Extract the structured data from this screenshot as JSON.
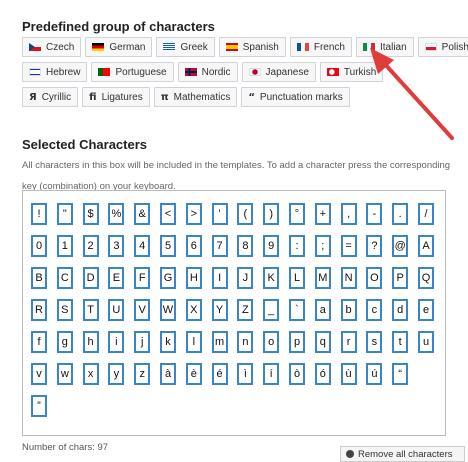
{
  "predefined": {
    "title": "Predefined group of characters",
    "row1": [
      {
        "label": "Czech",
        "icon": "czech-flag-icon"
      },
      {
        "label": "German",
        "icon": "german-flag-icon"
      },
      {
        "label": "Greek",
        "icon": "greek-flag-icon"
      },
      {
        "label": "Spanish",
        "icon": "spanish-flag-icon"
      },
      {
        "label": "French",
        "icon": "french-flag-icon"
      },
      {
        "label": "Italian",
        "icon": "italian-flag-icon"
      },
      {
        "label": "Polish",
        "icon": "polish-flag-icon"
      }
    ],
    "row2": [
      {
        "label": "Hebrew",
        "icon": "israeli-flag-icon"
      },
      {
        "label": "Portuguese",
        "icon": "portuguese-flag-icon"
      },
      {
        "label": "Nordic",
        "icon": "norwegian-flag-icon"
      },
      {
        "label": "Japanese",
        "icon": "japanese-flag-icon"
      },
      {
        "label": "Turkish",
        "icon": "turkish-flag-icon"
      }
    ],
    "row3": [
      {
        "label": "Cyrillic",
        "symbol": "Я",
        "icon": "cyrillic-icon"
      },
      {
        "label": "Ligatures",
        "symbol": "ﬁ",
        "icon": "ligature-icon"
      },
      {
        "label": "Mathematics",
        "symbol": "π",
        "icon": "pi-icon"
      },
      {
        "label": "Punctuation marks",
        "symbol": "“",
        "icon": "quote-icon"
      }
    ]
  },
  "selected": {
    "title": "Selected Characters",
    "description": "All characters in this box will be included in the templates. To add a character press the corresponding key (combination) on your keyboard.",
    "characters": [
      [
        "!",
        "\"",
        "$",
        "%",
        "&",
        "<",
        ">",
        "'",
        "(",
        ")",
        "°",
        "+",
        ",",
        "-",
        ".",
        "/"
      ],
      [
        "0",
        "1",
        "2",
        "3",
        "4",
        "5",
        "6",
        "7",
        "8",
        "9",
        ":",
        ";",
        "=",
        "?",
        "@",
        "A"
      ],
      [
        "B",
        "C",
        "D",
        "E",
        "F",
        "G",
        "H",
        "I",
        "J",
        "K",
        "L",
        "M",
        "N",
        "O",
        "P",
        "Q"
      ],
      [
        "R",
        "S",
        "T",
        "U",
        "V",
        "W",
        "X",
        "Y",
        "Z",
        "_",
        "`",
        "a",
        "b",
        "c",
        "d",
        "e"
      ],
      [
        "f",
        "g",
        "h",
        "i",
        "j",
        "k",
        "l",
        "m",
        "n",
        "o",
        "p",
        "q",
        "r",
        "s",
        "t",
        "u"
      ],
      [
        "v",
        "w",
        "x",
        "y",
        "z",
        "à",
        "è",
        "é",
        "ì",
        "í",
        "ò",
        "ó",
        "ù",
        "ú",
        "“"
      ],
      [
        "”"
      ]
    ]
  },
  "footer": {
    "count_label": "Number of chars: 97",
    "remove_button": "Remove all characters"
  },
  "colors": {
    "key_border": "#3a84c9",
    "arrow": "#e23b3b"
  }
}
